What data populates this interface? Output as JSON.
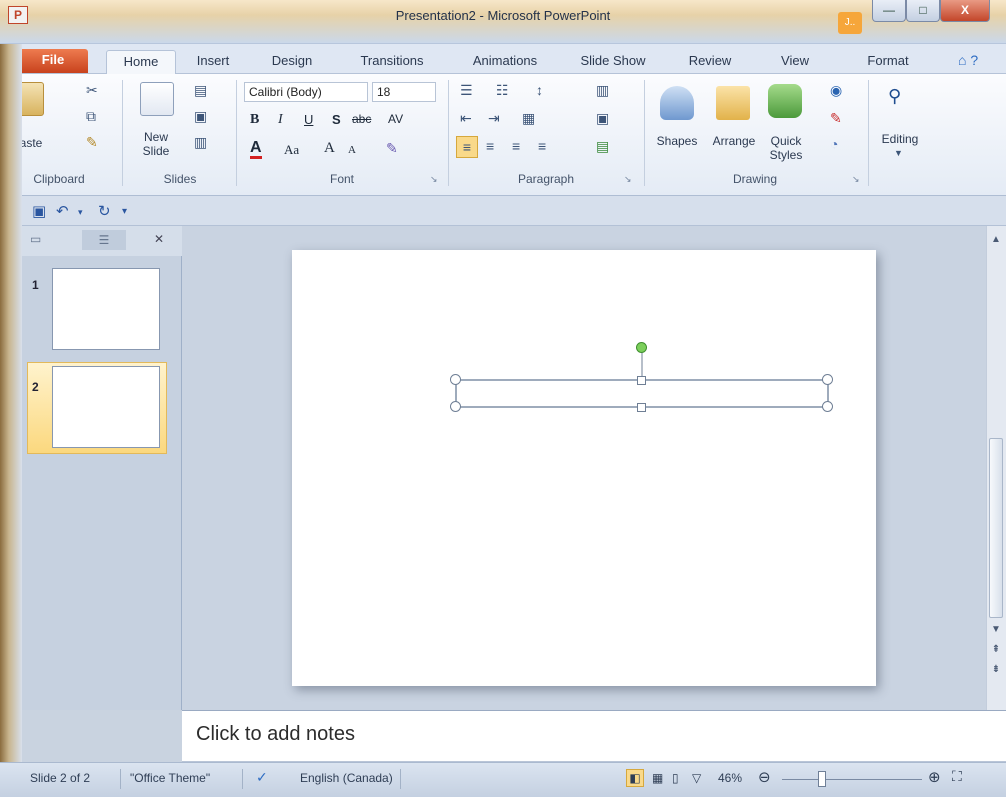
{
  "window": {
    "app_icon": "P",
    "title": "Presentation2 - Microsoft PowerPoint",
    "minimize": "—",
    "maximize": "□",
    "close": "X",
    "context_badge": "J..",
    "help": "⌂ ?"
  },
  "tabs": [
    "File",
    "Home",
    "Insert",
    "Design",
    "Transitions",
    "Animations",
    "Slide Show",
    "Review",
    "View",
    "Format"
  ],
  "ribbon": {
    "clipboard": {
      "paste": "Paste",
      "label": "Clipboard"
    },
    "slides": {
      "new_slide_1": "New",
      "new_slide_2": "Slide",
      "label": "Slides"
    },
    "font": {
      "font_name": "Calibri (Body)",
      "font_size": "18",
      "bold": "B",
      "italic": "I",
      "underline": "U",
      "shadow": "S",
      "strike": "abc",
      "spacing": "AV",
      "font_color": "A",
      "change_case": "Aa",
      "grow": "A",
      "shrink": "A",
      "label": "Font"
    },
    "paragraph": {
      "label": "Paragraph"
    },
    "drawing": {
      "shapes": "Shapes",
      "arrange": "Arrange",
      "quick_styles_1": "Quick",
      "quick_styles_2": "Styles",
      "label": "Drawing"
    },
    "editing": {
      "label": "Editing"
    }
  },
  "thumbnails": [
    {
      "number": "1"
    },
    {
      "number": "2"
    }
  ],
  "notes_placeholder": "Click to add notes",
  "status": {
    "slide_info": "Slide 2 of 2",
    "theme": "\"Office Theme\"",
    "language": "English (Canada)",
    "zoom": "46%"
  },
  "colors": {
    "file_tab": "#d85a2f",
    "selection_thumb": "#fbd87e",
    "rotation_handle": "#7ccf5b"
  }
}
